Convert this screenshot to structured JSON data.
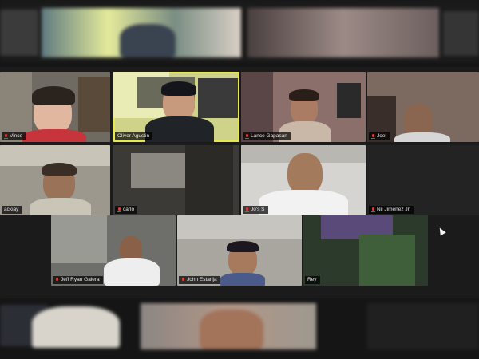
{
  "participants": [
    {
      "name": "Vince",
      "active": false
    },
    {
      "name": "Oliver Agustin",
      "active": true
    },
    {
      "name": "Lance Gapasan",
      "active": false
    },
    {
      "name": "Joel",
      "active": false
    },
    {
      "name": "ackiay",
      "active": false
    },
    {
      "name": "carlo",
      "active": false
    },
    {
      "name": "Jo's S",
      "active": false
    },
    {
      "name": "Nil Jimenez Jr.",
      "active": false
    },
    {
      "name": "Jeff Ryan Galera",
      "active": false
    },
    {
      "name": "John Estarija",
      "active": false
    },
    {
      "name": "Rey",
      "active": false
    }
  ],
  "colors": {
    "background": "#161616",
    "active_speaker_border": "#e7e84a",
    "muted_mic": "#e03b3b"
  },
  "icons": {
    "muted": "microphone-muted-icon",
    "pointer": "mouse-cursor-icon"
  }
}
